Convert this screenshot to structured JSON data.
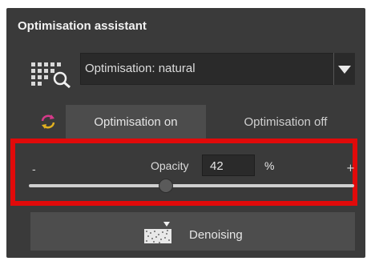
{
  "panel": {
    "title": "Optimisation assistant"
  },
  "preset": {
    "selected": "Optimisation: natural"
  },
  "mode": {
    "on_label": "Optimisation on",
    "off_label": "Optimisation off"
  },
  "opacity": {
    "label": "Opacity",
    "value": "42",
    "unit": "%",
    "min_symbol": "-",
    "max_symbol": "+",
    "slider_fraction": 0.42
  },
  "denoise": {
    "label": "Denoising"
  },
  "colors": {
    "highlight": "#e10a0a",
    "panel_bg": "#3a3a3a",
    "button_bg": "#4d4d4d"
  }
}
